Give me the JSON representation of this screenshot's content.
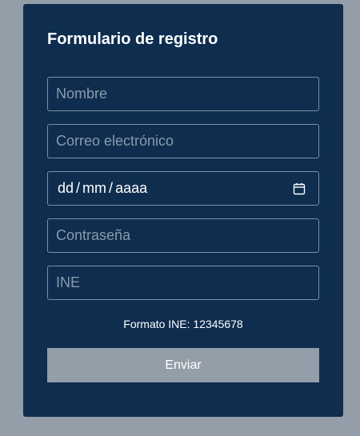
{
  "form": {
    "title": "Formulario de registro",
    "name_placeholder": "Nombre",
    "email_placeholder": "Correo electrónico",
    "date": {
      "day": "dd",
      "month": "mm",
      "year": "aaaa",
      "separator": "/",
      "icon": "calendar-icon"
    },
    "password_placeholder": "Contraseña",
    "ine_placeholder": "INE",
    "ine_hint": "Formato INE: 12345678",
    "submit_label": "Enviar"
  },
  "colors": {
    "page_background": "#949ea8",
    "card_background": "#0e2d4f",
    "input_border": "#7f8fa3",
    "placeholder_text": "#8c9aab",
    "button_background": "#949ea8",
    "text": "#ffffff"
  }
}
